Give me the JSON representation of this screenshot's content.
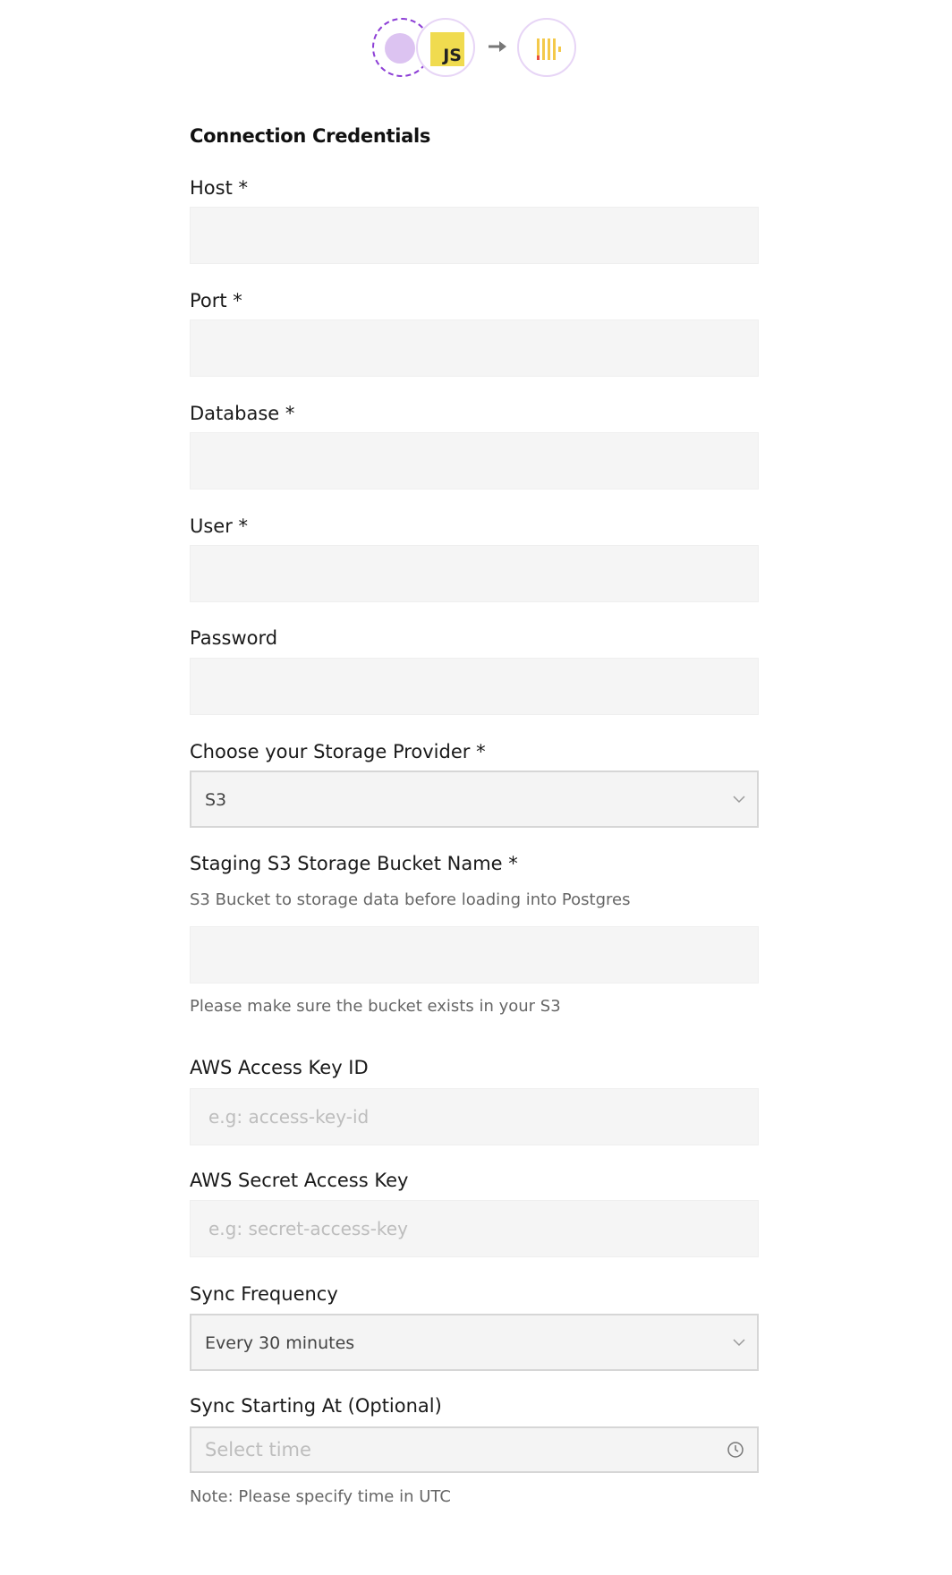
{
  "header": {
    "source_logo": "dashed-circle-logo",
    "js_badge": "JS",
    "arrow_icon": "arrow-right-icon",
    "destination_logo": "clickhouse-icon"
  },
  "section_title": "Connection Credentials",
  "fields": {
    "host": {
      "label": "Host *",
      "value": ""
    },
    "port": {
      "label": "Port *",
      "value": ""
    },
    "database": {
      "label": "Database *",
      "value": ""
    },
    "user": {
      "label": "User *",
      "value": ""
    },
    "password": {
      "label": "Password",
      "value": ""
    },
    "storage_provider": {
      "label": "Choose your Storage Provider *",
      "value": "S3"
    },
    "bucket": {
      "label": "Staging S3 Storage Bucket Name *",
      "description": "S3 Bucket to storage data before loading into Postgres",
      "help": "Please make sure the bucket exists in your S3",
      "value": ""
    },
    "access_key": {
      "label": "AWS Access Key ID",
      "placeholder": "e.g: access-key-id"
    },
    "secret_key": {
      "label": "AWS Secret Access Key",
      "placeholder": "e.g: secret-access-key"
    },
    "sync_frequency": {
      "label": "Sync Frequency",
      "value": "Every 30 minutes"
    },
    "sync_start": {
      "label": "Sync Starting At (Optional)",
      "placeholder": "Select time",
      "note": "Note: Please specify time in UTC"
    }
  },
  "colors": {
    "accent_purple": "#8d3fd6",
    "js_yellow": "#f0db4f",
    "input_bg": "#f5f5f5"
  }
}
